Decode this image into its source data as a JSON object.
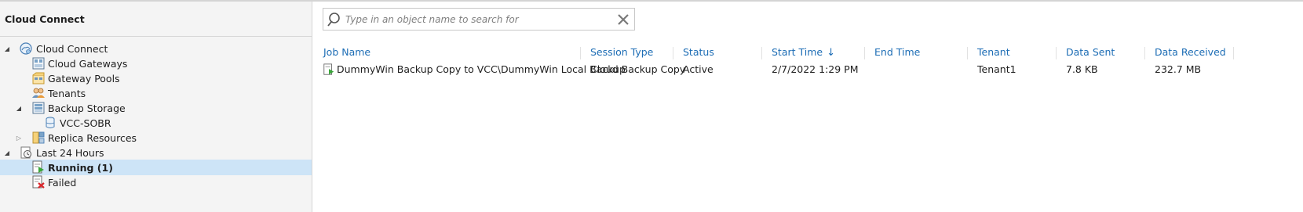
{
  "sidebar": {
    "title": "Cloud Connect",
    "tree": [
      {
        "label": "Cloud Connect",
        "toggle": "◢",
        "icon": "cloud-connect-icon"
      },
      {
        "label": "Cloud Gateways",
        "toggle": "",
        "icon": "cloud-gateways-icon"
      },
      {
        "label": "Gateway Pools",
        "toggle": "",
        "icon": "gateway-pools-icon"
      },
      {
        "label": "Tenants",
        "toggle": "",
        "icon": "tenants-icon"
      },
      {
        "label": "Backup Storage",
        "toggle": "◢",
        "icon": "backup-storage-icon"
      },
      {
        "label": "VCC-SOBR",
        "toggle": "",
        "icon": "repository-icon"
      },
      {
        "label": "Replica Resources",
        "toggle": "▷",
        "icon": "replica-resources-icon"
      },
      {
        "label": "Last 24 Hours",
        "toggle": "◢",
        "icon": "last-24-hours-icon"
      },
      {
        "label": "Running (1)",
        "toggle": "",
        "icon": "running-icon",
        "selected": true
      },
      {
        "label": "Failed",
        "toggle": "",
        "icon": "failed-icon"
      }
    ]
  },
  "search": {
    "placeholder": "Type in an object name to search for",
    "value": ""
  },
  "grid": {
    "columns": [
      {
        "label": "Job Name"
      },
      {
        "label": "Session Type"
      },
      {
        "label": "Status"
      },
      {
        "label": "Start Time",
        "sort": "↓"
      },
      {
        "label": "End Time"
      },
      {
        "label": "Tenant"
      },
      {
        "label": "Data Sent"
      },
      {
        "label": "Data Received"
      }
    ],
    "rows": [
      {
        "job_name": "DummyWin Backup Copy to VCC\\DummyWin Local Backup",
        "session_type": "Cloud Backup Copy",
        "status": "Active",
        "start_time": "2/7/2022 1:29 PM",
        "end_time": "",
        "tenant": "Tenant1",
        "data_sent": "7.8 KB",
        "data_received": "232.7 MB"
      }
    ]
  },
  "colors": {
    "accent": "#1d6db5",
    "selection": "#cde4f7",
    "running_green": "#3aa63a",
    "failed_red": "#d9262b"
  }
}
